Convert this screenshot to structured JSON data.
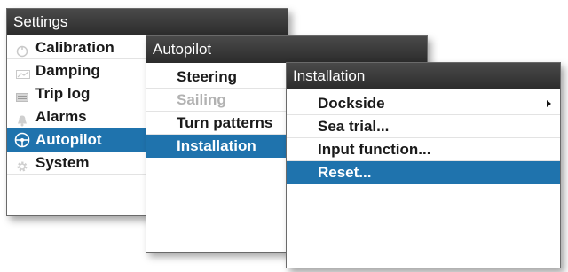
{
  "settings": {
    "title": "Settings",
    "items": [
      {
        "label": "Calibration",
        "icon": "calibration-icon"
      },
      {
        "label": "Damping",
        "icon": "damping-icon"
      },
      {
        "label": "Trip log",
        "icon": "trip-log-icon"
      },
      {
        "label": "Alarms",
        "icon": "alarm-bell-icon"
      },
      {
        "label": "Autopilot",
        "icon": "autopilot-wheel-icon",
        "selected": true
      },
      {
        "label": "System",
        "icon": "gear-icon"
      }
    ]
  },
  "autopilot": {
    "title": "Autopilot",
    "items": [
      {
        "label": "Steering"
      },
      {
        "label": "Sailing",
        "disabled": true
      },
      {
        "label": "Turn patterns"
      },
      {
        "label": "Installation",
        "selected": true
      }
    ]
  },
  "installation": {
    "title": "Installation",
    "items": [
      {
        "label": "Dockside",
        "submenu": true
      },
      {
        "label": "Sea trial..."
      },
      {
        "label": "Input function..."
      },
      {
        "label": "Reset...",
        "selected": true
      }
    ]
  },
  "colors": {
    "selection": "#1f73ad",
    "titlebar": "#3a3a3a",
    "disabled_text": "#b2b2b2"
  }
}
